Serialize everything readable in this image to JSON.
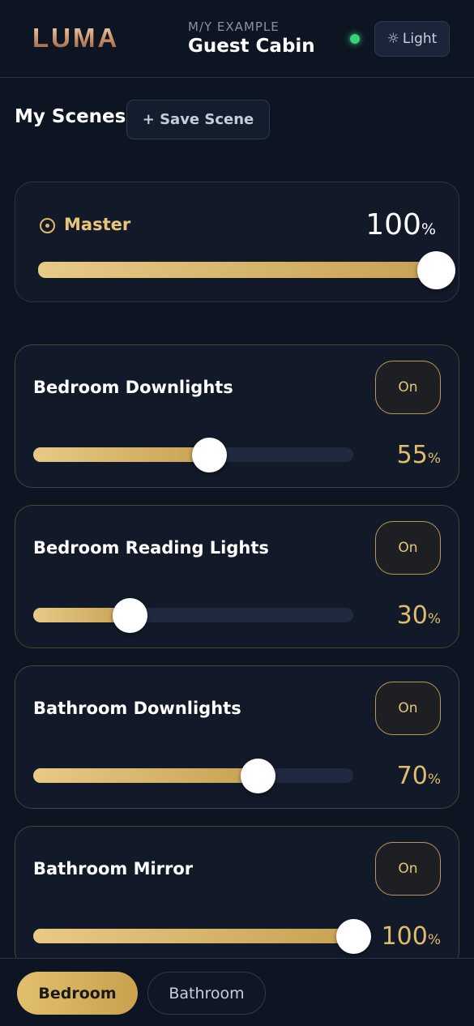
{
  "header": {
    "logo_text": "LUMA",
    "vessel": "M/Y EXAMPLE",
    "cabin": "Guest Cabin",
    "theme_button": "Light",
    "status_color": "#3ecf7a"
  },
  "scenes": {
    "title": "My Scenes",
    "save_label": "+ Save Scene"
  },
  "master": {
    "label": "Master",
    "value": "100",
    "unit": "%",
    "level": 100
  },
  "lights": [
    {
      "name": "Bedroom Downlights",
      "toggle": "On",
      "value": "55",
      "unit": "%",
      "level": 55
    },
    {
      "name": "Bedroom Reading Lights",
      "toggle": "On",
      "value": "30",
      "unit": "%",
      "level": 30
    },
    {
      "name": "Bathroom Downlights",
      "toggle": "On",
      "value": "70",
      "unit": "%",
      "level": 70
    },
    {
      "name": "Bathroom Mirror",
      "toggle": "On",
      "value": "100",
      "unit": "%",
      "level": 100
    }
  ],
  "tabs": [
    {
      "label": "Bedroom",
      "active": true
    },
    {
      "label": "Bathroom",
      "active": false
    }
  ],
  "colors": {
    "accent": "#e1bc6c",
    "background": "#0d1422",
    "card": "#121a29"
  }
}
